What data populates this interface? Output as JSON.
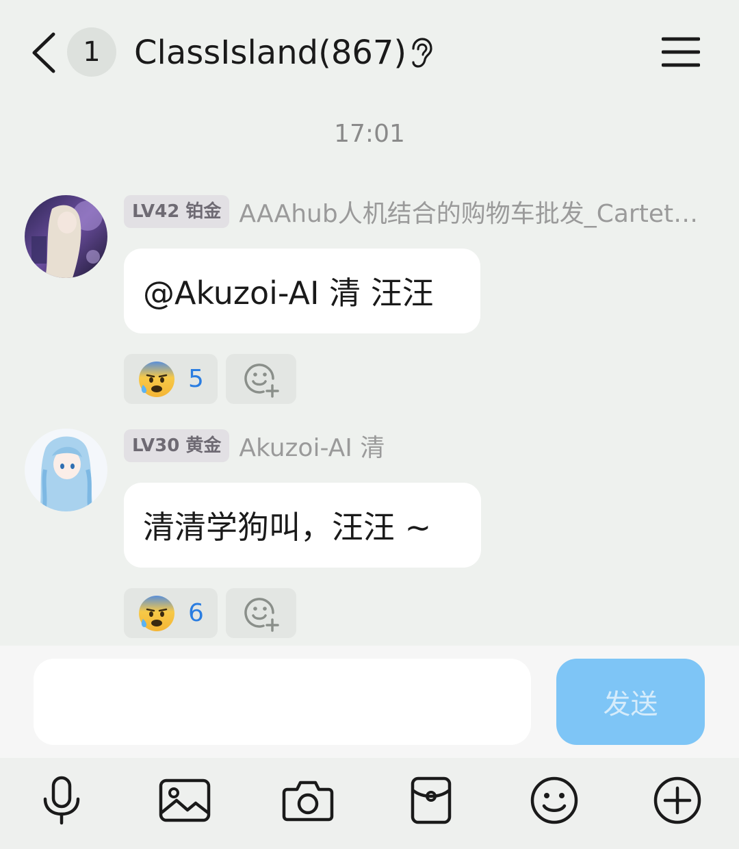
{
  "header": {
    "unread_count": "1",
    "title": "ClassIsland(867)"
  },
  "timestamp": "17:01",
  "messages": [
    {
      "level": "LV42 铂金",
      "sender": "AAAhub人机结合的购物车批发_Carteth...",
      "text": "@Akuzoi-AI 清 汪汪",
      "reaction_count": "5"
    },
    {
      "level": "LV30 黄金",
      "sender": "Akuzoi-AI 清",
      "text": "清清学狗叫，汪汪 ~",
      "reaction_count": "6"
    }
  ],
  "input": {
    "value": "",
    "send_label": "发送"
  },
  "toolbar_icons": [
    "microphone-icon",
    "image-icon",
    "camera-icon",
    "red-packet-icon",
    "emoji-icon",
    "plus-icon"
  ],
  "colors": {
    "background": "#eef1ee",
    "send_button": "#7ec5f6",
    "reaction_count": "#2a7de1"
  }
}
